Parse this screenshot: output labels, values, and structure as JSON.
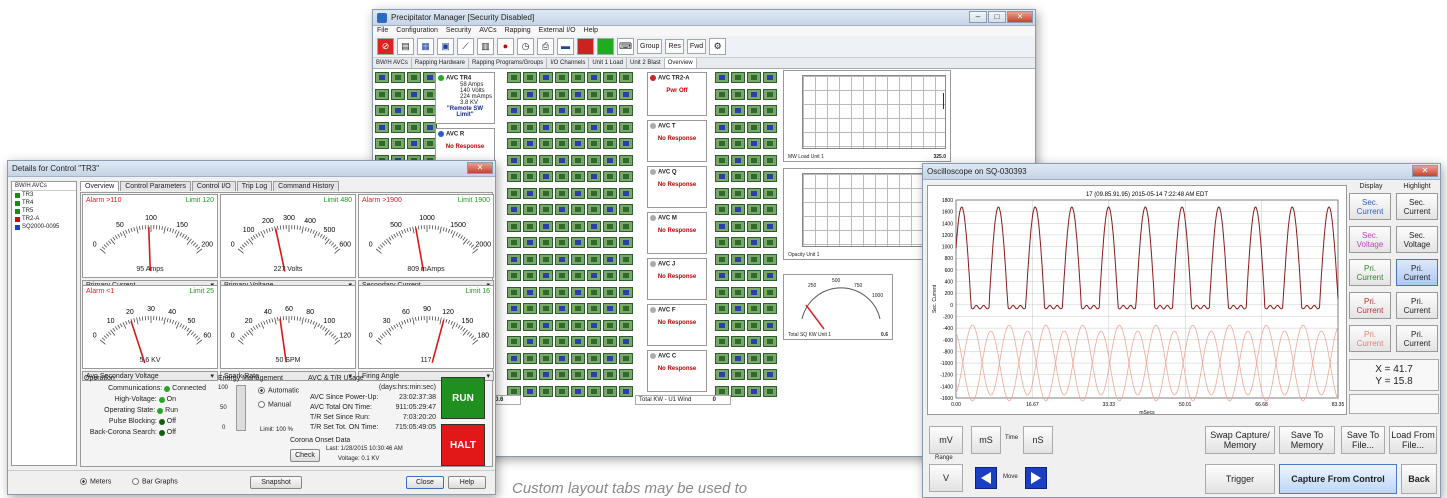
{
  "pm": {
    "title": "Precipitator Manager [Security Disabled]",
    "menu": [
      "File",
      "Configuration",
      "Security",
      "AVCs",
      "Rapping",
      "External I/O",
      "Help"
    ],
    "toolbar_text": [
      "Group",
      "Res",
      "Fwd"
    ],
    "tabs": [
      "BW/H AVCs",
      "Rapping Hardware",
      "Rapping Programs/Groups",
      "I/O Channels",
      "Unit 1 Load",
      "Unit 2 Blast",
      "Overview"
    ],
    "panels": [
      {
        "name": "AVC TR4",
        "lines": [
          "58 Amps",
          "140 Volts",
          "224 mAmps",
          "3.8 KV"
        ],
        "status": "\"Remote SW Limit\""
      },
      {
        "name": "AVC R",
        "status": "No Response"
      },
      {
        "name": "AVC TR2-A",
        "status": "Pwr Off"
      },
      {
        "name": "AVC T",
        "status": "No Response"
      },
      {
        "name": "AVC Q",
        "status": "No Response"
      },
      {
        "name": "AVC M",
        "status": "No Response"
      },
      {
        "name": "AVC J",
        "status": "No Response"
      },
      {
        "name": "AVC F",
        "status": "No Response"
      },
      {
        "name": "AVC C",
        "status": "No Response"
      }
    ],
    "chart1_label": "MW Load Unit 1",
    "chart1_value": "325.0",
    "chart2_label": "Opacity Unit 1",
    "kw_meter_label": "Total SQ KW Unit 1",
    "kw_meter_value": "0.6",
    "kw_meter_ticks": [
      "250",
      "500",
      "750",
      "1000"
    ],
    "total_kw_label": "Total KW - U1 Wind",
    "total_kw_value": "0",
    "left_value": "0.6"
  },
  "det": {
    "title": "Details for Control \"TR3\"",
    "tree_header": "BW/H AVCs",
    "tree": [
      {
        "label": "TR3",
        "color": "#1a8a1a"
      },
      {
        "label": "TR4",
        "color": "#1a8a1a"
      },
      {
        "label": "TR5",
        "color": "#1a8a1a"
      },
      {
        "label": "TR2-A",
        "color": "#c01010"
      },
      {
        "label": "SQ2000-0095",
        "color": "#2040c0"
      }
    ],
    "tabs": [
      "Overview",
      "Control Parameters",
      "Control I/O",
      "Trip Log",
      "Command History"
    ],
    "meters": [
      {
        "alarm": "Alarm >110",
        "limit": "Limit 120",
        "ticks": [
          "0",
          "50",
          "100",
          "150",
          "200"
        ],
        "reading": "95 Amps",
        "select": "Primary Current",
        "frac": 0.48
      },
      {
        "alarm": "",
        "limit": "Limit 480",
        "ticks": [
          "0",
          "100",
          "200",
          "300",
          "400",
          "500",
          "600"
        ],
        "reading": "227 Volts",
        "select": "Primary Voltage",
        "frac": 0.38
      },
      {
        "alarm": "Alarm >1900",
        "limit": "Limit 1900",
        "ticks": [
          "0",
          "500",
          "1000",
          "1500",
          "2000"
        ],
        "reading": "809 mAmps",
        "select": "Secondary Current",
        "frac": 0.4
      },
      {
        "alarm": "Alarm <1",
        "limit": "Limit 25",
        "ticks": [
          "0",
          "10",
          "20",
          "30",
          "40",
          "50",
          "60"
        ],
        "reading": "5.6 KV",
        "select": "Avg Secondary Voltage",
        "frac": 0.32
      },
      {
        "alarm": "",
        "limit": "",
        "ticks": [
          "0",
          "20",
          "40",
          "60",
          "80",
          "100",
          "120"
        ],
        "reading": "50 SPM",
        "select": "Spark Rate",
        "frac": 0.42
      },
      {
        "alarm": "",
        "limit": "Limit 16",
        "ticks": [
          "0",
          "30",
          "60",
          "90",
          "120",
          "150",
          "180"
        ],
        "reading": "117",
        "select": "Firing Angle",
        "frac": 0.65
      }
    ],
    "operation": {
      "title": "Operation",
      "rows": [
        {
          "label": "Communications:",
          "value": "Connected"
        },
        {
          "label": "High-Voltage:",
          "value": "On"
        },
        {
          "label": "Operating State:",
          "value": "Run"
        },
        {
          "label": "Pulse Blocking:",
          "value": "Off"
        },
        {
          "label": "Back-Corona Search:",
          "value": "Off"
        }
      ]
    },
    "energy": {
      "title": "Energy Management",
      "scale": [
        "100",
        "50",
        "0"
      ],
      "automatic": "Automatic",
      "manual": "Manual",
      "limit": "Limit: 100 %"
    },
    "usage": {
      "title": "AVC & T/R Usage",
      "units": "(days:hrs:min:sec)",
      "rows": [
        {
          "label": "AVC Since Power-Up:",
          "value": "23:02:37:38"
        },
        {
          "label": "AVC Total ON Time:",
          "value": "911:05:29:47"
        },
        {
          "label": "T/R Set Since Run:",
          "value": "7:03:20:20"
        },
        {
          "label": "T/R Set Tot. ON Time:",
          "value": "715:05:49:05"
        }
      ]
    },
    "corona": {
      "title": "Corona Onset Data",
      "check": "Check",
      "last": "Last: 1/28/2015 10:30:46 AM",
      "voltage": "Voltage: 0.1 KV"
    },
    "run": "RUN",
    "halt": "HALT",
    "footer": {
      "meters": "Meters",
      "bar_graphs": "Bar Graphs",
      "snapshot": "Snapshot",
      "close": "Close",
      "help": "Help"
    }
  },
  "osc": {
    "title": "Oscilloscope on SQ-030393",
    "plot_title": "17 (09.85.91.95)  2015-05-14 7:22:48 AM EDT",
    "ylabel": "Sec. Current",
    "xlabel": "mSecs",
    "yticks": [
      "1800",
      "1600",
      "1400",
      "1200",
      "1000",
      "800",
      "600",
      "400",
      "200",
      "0",
      "-200",
      "-400",
      "-600",
      "-800",
      "-1000",
      "-1200",
      "-1400",
      "-1600"
    ],
    "xticks": [
      "0.00",
      "16.67",
      "33.33",
      "50.01",
      "66.68",
      "83.35"
    ],
    "display_header": "Display",
    "highlight_header": "Highlight",
    "display_buttons": [
      {
        "label": "Sec. Current",
        "color": "#2a5bd0"
      },
      {
        "label": "Sec. Voltage",
        "color": "#c040c0"
      },
      {
        "label": "Pri. Current",
        "color": "#2a8a2a"
      },
      {
        "label": "Pri. Current",
        "color": "#c03030"
      },
      {
        "label": "Pri. Current",
        "color": "#e08070"
      }
    ],
    "highlight_buttons": [
      "Sec. Current",
      "Sec. Voltage",
      "Pri. Current",
      "Pri. Current",
      "Pri. Current"
    ],
    "xy_x": "X = 41.7",
    "xy_y": "Y = 15.8",
    "range_label": "Range",
    "time_label": "Time",
    "move_label": "Move",
    "btn_mv": "mV",
    "btn_v": "V",
    "btn_ms": "mS",
    "btn_ns": "nS",
    "btn_swap": "Swap Capture/ Memory",
    "btn_save_mem": "Save To Memory",
    "btn_save_file": "Save To File...",
    "btn_load": "Load From File...",
    "btn_trigger": "Trigger",
    "btn_capture": "Capture From Control",
    "btn_back": "Back"
  },
  "caption": "Custom layout tabs may be used to",
  "colors": {
    "run": "#1f8f1f",
    "halt": "#e21818",
    "trace_dark": "#8b1a1a",
    "trace_light": "#f0a898"
  }
}
